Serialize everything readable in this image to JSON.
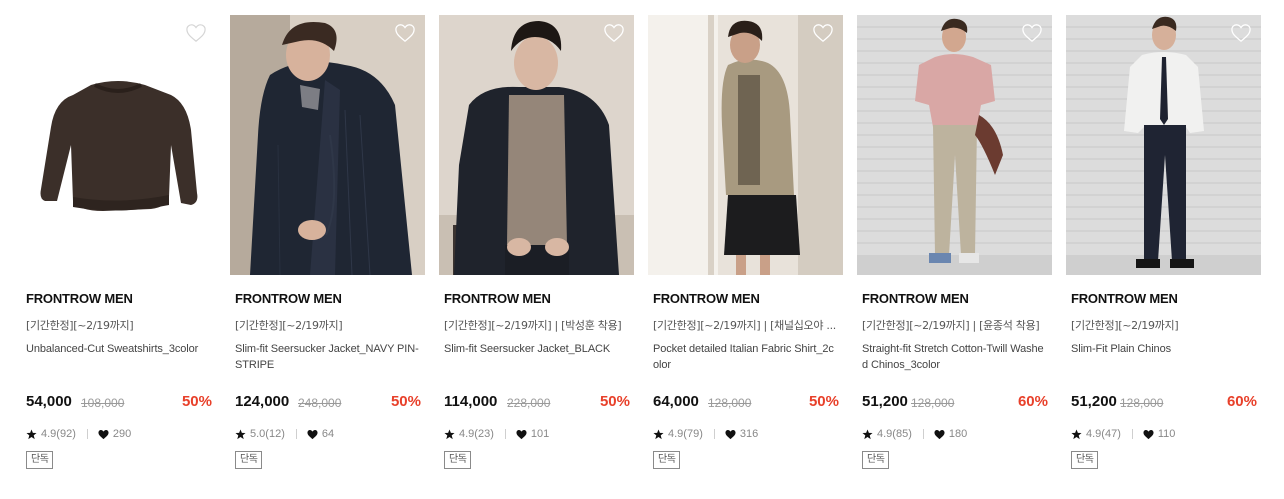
{
  "products": [
    {
      "brand": "FRONTROW MEN",
      "promo": "[기간한정][~2/19까지]",
      "name": "Unbalanced-Cut Sweatshirts_3color",
      "price": "54,000",
      "original_price": "108,000",
      "discount": "50%",
      "rating": "4.9(92)",
      "likes": "290",
      "badge": "단독",
      "wishlisted": false
    },
    {
      "brand": "FRONTROW MEN",
      "promo": "[기간한정][~2/19까지]",
      "name": "Slim-fit Seersucker Jacket_NAVY PIN-STRIPE",
      "price": "124,000",
      "original_price": "248,000",
      "discount": "50%",
      "rating": "5.0(12)",
      "likes": "64",
      "badge": "단독",
      "wishlisted": false
    },
    {
      "brand": "FRONTROW MEN",
      "promo": "[기간한정][~2/19까지] | [박성훈 착용]",
      "name": "Slim-fit Seersucker Jacket_BLACK",
      "price": "114,000",
      "original_price": "228,000",
      "discount": "50%",
      "rating": "4.9(23)",
      "likes": "101",
      "badge": "단독",
      "wishlisted": false
    },
    {
      "brand": "FRONTROW MEN",
      "promo": "[기간한정][~2/19까지] | [채널십오야 ...",
      "name": "Pocket detailed Italian Fabric Shirt_2color",
      "price": "64,000",
      "original_price": "128,000",
      "discount": "50%",
      "rating": "4.9(79)",
      "likes": "316",
      "badge": "단독",
      "wishlisted": false
    },
    {
      "brand": "FRONTROW MEN",
      "promo": "[기간한정][~2/19까지] | [윤종석 착용]",
      "name": "Straight-fit Stretch Cotton-Twill Washed Chinos_3color",
      "price": "51,200",
      "original_price": "128,000",
      "discount": "60%",
      "rating": "4.9(85)",
      "likes": "180",
      "badge": "단독",
      "wishlisted": false
    },
    {
      "brand": "FRONTROW MEN",
      "promo": "[기간한정][~2/19까지]",
      "name": "Slim-Fit Plain Chinos",
      "price": "51,200",
      "original_price": "128,000",
      "discount": "60%",
      "rating": "4.9(47)",
      "likes": "110",
      "badge": "단독",
      "wishlisted": false
    }
  ],
  "icons": {
    "wishlist": "heart-outline-icon",
    "rating": "star-icon",
    "likes": "heart-filled-icon"
  },
  "colors": {
    "discount": "#e8402a",
    "text": "#111111",
    "muted": "#888888"
  }
}
